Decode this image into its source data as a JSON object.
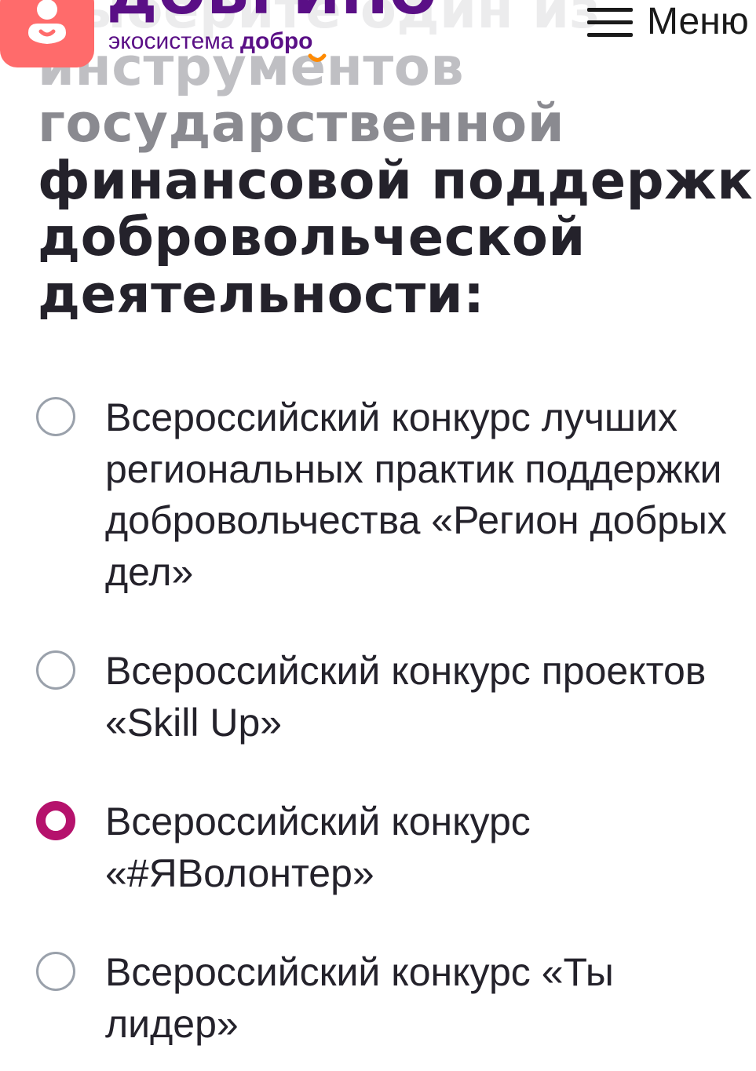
{
  "header": {
    "brand_name": "ДОБРИНО",
    "tagline_prefix": "экосистема ",
    "tagline_accent": "добро",
    "menu_label": "Меню"
  },
  "question": {
    "line1": "Выберите один из",
    "line2": "инструментов",
    "line3": "государственной",
    "line4": "финансовой поддержки",
    "line5": "добровольческой",
    "line6": "деятельности:"
  },
  "options": [
    {
      "label": "Всероссийский конкурс лучших региональных практик поддержки добровольчества «Регион добрых дел»",
      "selected": false
    },
    {
      "label": "Всероссийский конкурс проектов «Skill Up»",
      "selected": false
    },
    {
      "label": "Всероссийский конкурс «#ЯВолонтер»",
      "selected": true
    },
    {
      "label": "Всероссийский конкурс «Ты лидер»",
      "selected": false
    }
  ],
  "colors": {
    "brand_purple": "#5a0f86",
    "logo_coral": "#ff6b6b",
    "smile_orange": "#ff8a00",
    "selected_radio": "#b5126c",
    "text_dark": "#24222b"
  }
}
